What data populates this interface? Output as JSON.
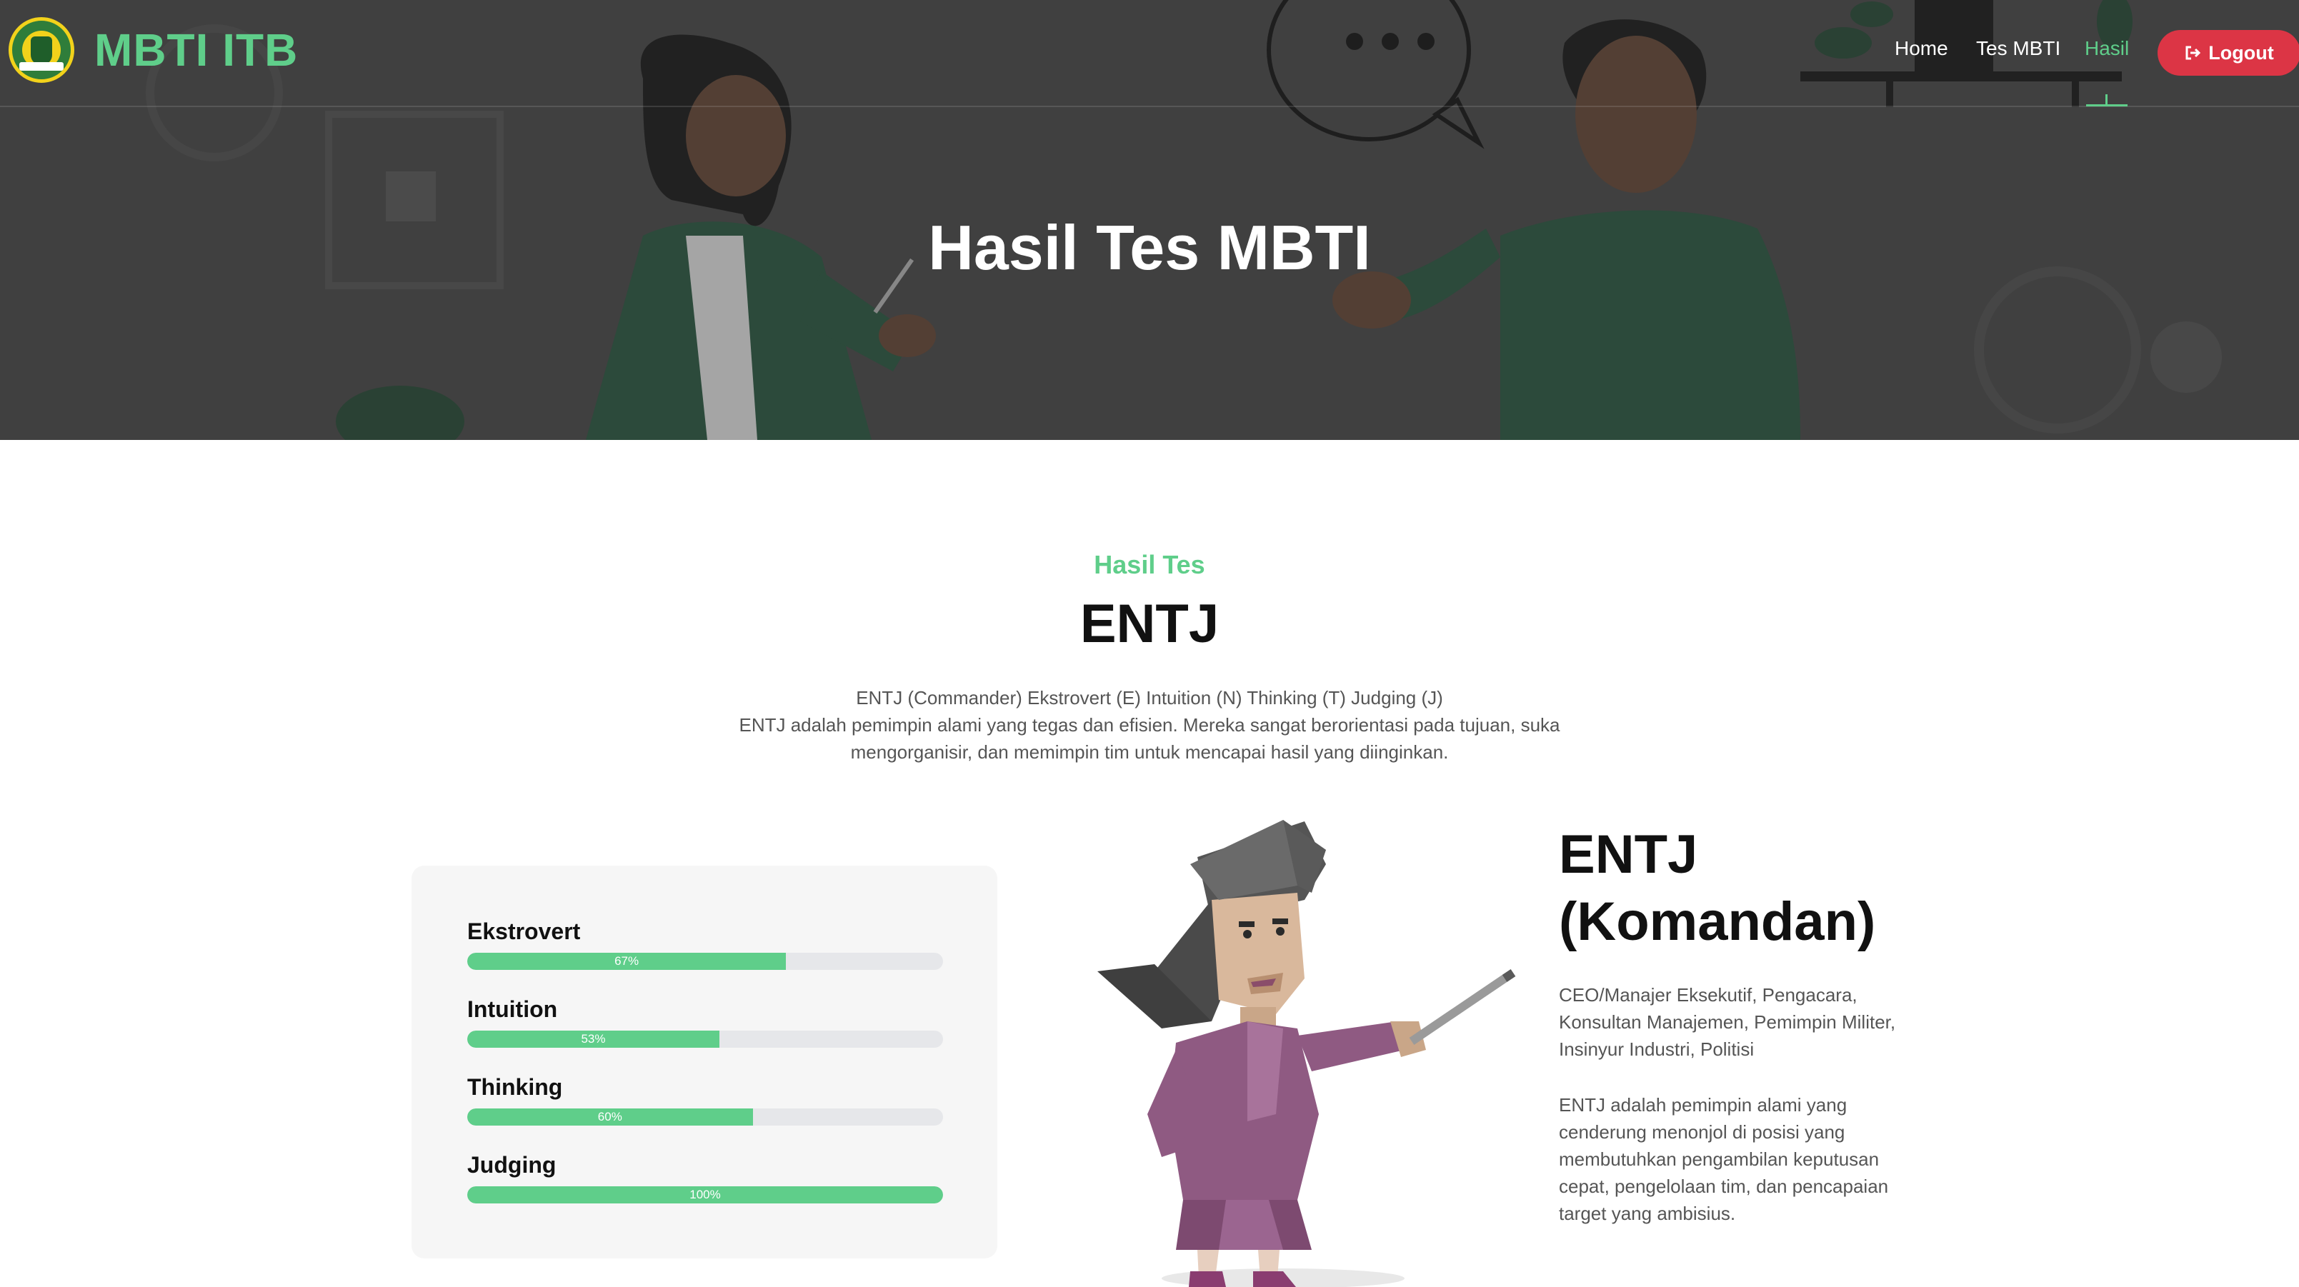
{
  "brand": {
    "name": "MBTI ITB",
    "logo_icon": "university-seal-icon"
  },
  "nav": {
    "items": [
      {
        "label": "Home",
        "active": false
      },
      {
        "label": "Tes MBTI",
        "active": false
      },
      {
        "label": "Hasil",
        "active": true
      }
    ],
    "logout_label": "Logout",
    "logout_icon": "sign-out-icon"
  },
  "hero": {
    "title": "Hasil Tes MBTI"
  },
  "result": {
    "subtitle": "Hasil Tes",
    "type": "ENTJ",
    "summary_line1": "ENTJ (Commander) Ekstrovert (E) Intuition (N) Thinking (T) Judging (J)",
    "summary_line2": "ENTJ adalah pemimpin alami yang tegas dan efisien. Mereka sangat berorientasi pada tujuan, suka mengorganisir, dan memimpin tim untuk mencapai hasil yang diinginkan."
  },
  "traits": [
    {
      "label": "Ekstrovert",
      "percent": 67,
      "percent_text": "67%"
    },
    {
      "label": "Intuition",
      "percent": 53,
      "percent_text": "53%"
    },
    {
      "label": "Thinking",
      "percent": 60,
      "percent_text": "60%"
    },
    {
      "label": "Judging",
      "percent": 100,
      "percent_text": "100%"
    }
  ],
  "profile": {
    "title": "ENTJ (Komandan)",
    "careers": "CEO/Manajer Eksekutif, Pengacara, Konsultan Manajemen, Pemimpin Militer, Insinyur Industri, Politisi",
    "description": "ENTJ adalah pemimpin alami yang cenderung menonjol di posisi yang membutuhkan pengambilan keputusan cepat, pengelolaan tim, dan pencapaian target yang ambisius."
  },
  "colors": {
    "accent": "#5fce8a",
    "danger": "#dc3545",
    "hero_bg": "#4a4a4a",
    "card_bg": "#f6f6f6"
  }
}
